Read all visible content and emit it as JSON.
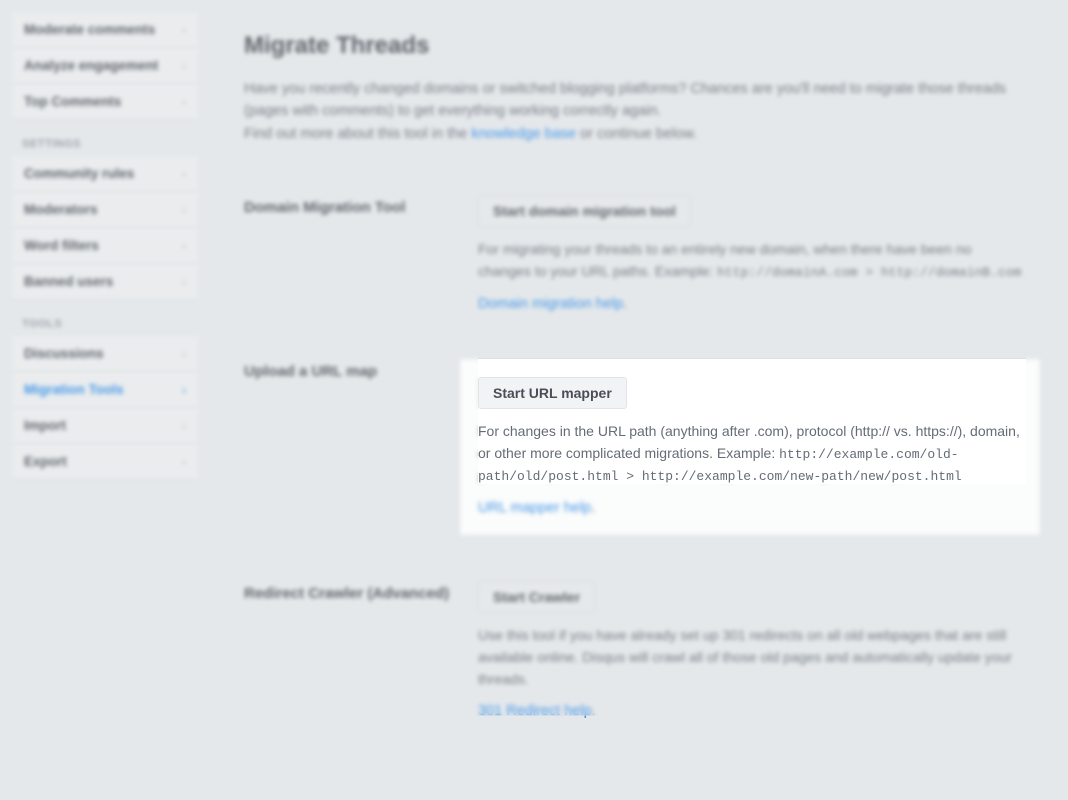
{
  "sidebar": {
    "group_moderation": [
      {
        "label": "Moderate comments"
      },
      {
        "label": "Analyze engagement"
      },
      {
        "label": "Top Comments"
      }
    ],
    "settings_header": "SETTINGS",
    "group_settings": [
      {
        "label": "Community rules"
      },
      {
        "label": "Moderators"
      },
      {
        "label": "Word filters"
      },
      {
        "label": "Banned users"
      }
    ],
    "tools_header": "TOOLS",
    "group_tools": [
      {
        "label": "Discussions",
        "active": false
      },
      {
        "label": "Migration Tools",
        "active": true
      },
      {
        "label": "Import",
        "active": false
      },
      {
        "label": "Export",
        "active": false
      }
    ]
  },
  "main": {
    "title": "Migrate Threads",
    "intro_line1": "Have you recently changed domains or switched blogging platforms? Chances are you'll need to migrate those threads (pages with comments) to get everything working correctly again.",
    "intro_line2a": "Find out more about this tool in the ",
    "intro_kb_link": "knowledge base",
    "intro_line2b": " or continue below.",
    "domain_tool": {
      "heading": "Domain Migration Tool",
      "button": "Start domain migration tool",
      "desc_a": "For migrating your threads to an entirely new domain, when there have been no changes to your URL paths. Example: ",
      "code": "http://domainA.com > http://domainB.com",
      "help": "Domain migration help",
      "help_suffix": "."
    },
    "url_map": {
      "heading": "Upload a URL map",
      "button": "Start URL mapper",
      "desc_a": "For changes in the URL path (anything after .com), protocol (http:// vs. https://), domain, or other more complicated migrations. Example: ",
      "code": "http://example.com/old-path/old/post.html > http://example.com/new-path/new/post.html",
      "help": "URL mapper help",
      "help_suffix": "."
    },
    "crawler": {
      "heading": "Redirect Crawler (Advanced)",
      "button": "Start Crawler",
      "desc": "Use this tool if you have already set up 301 redirects on all old webpages that are still available online. Disqus will crawl all of those old pages and automatically update your threads.",
      "help": "301 Redirect help",
      "help_suffix": "."
    }
  }
}
